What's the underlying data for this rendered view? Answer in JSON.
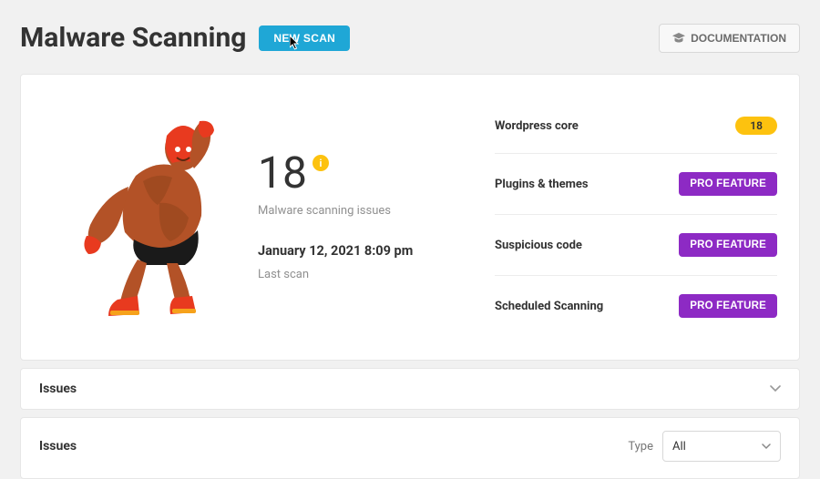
{
  "header": {
    "title": "Malware Scanning",
    "newscan_label": "NEW SCAN",
    "documentation_label": "DOCUMENTATION"
  },
  "overview": {
    "issue_count": "18",
    "issue_badge_icon": "i",
    "issue_subtitle": "Malware scanning issues",
    "last_scan_time": "January 12, 2021 8:09 pm",
    "last_scan_label": "Last scan",
    "stats": [
      {
        "label": "Wordpress core",
        "kind": "count",
        "value": "18"
      },
      {
        "label": "Plugins & themes",
        "kind": "pro",
        "value": "PRO FEATURE"
      },
      {
        "label": "Suspicious code",
        "kind": "pro",
        "value": "PRO FEATURE"
      },
      {
        "label": "Scheduled Scanning",
        "kind": "pro",
        "value": "PRO FEATURE"
      }
    ]
  },
  "accordion": {
    "title": "Issues"
  },
  "issues_panel": {
    "title": "Issues",
    "type_label": "Type",
    "type_selected": "All"
  },
  "colors": {
    "accent_blue": "#1fa7d6",
    "accent_purple": "#8d2ac4",
    "accent_yellow": "#fdc20f"
  }
}
